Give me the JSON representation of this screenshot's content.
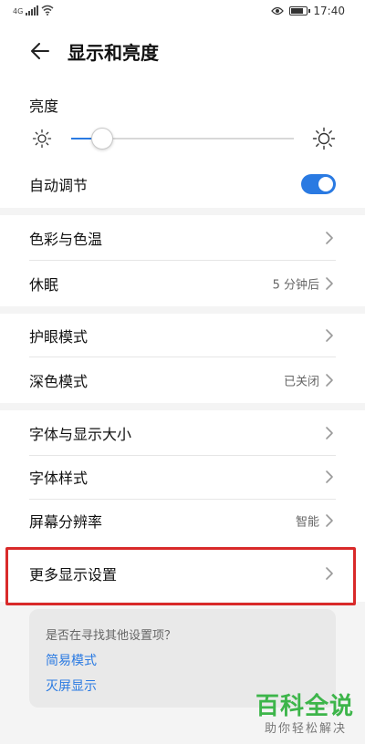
{
  "status_bar": {
    "network": "4G",
    "time": "17:40",
    "icons": [
      "signal-icon",
      "wifi-icon",
      "eye-icon",
      "battery-icon"
    ]
  },
  "header": {
    "title": "显示和亮度",
    "back_icon": "arrow-left-icon"
  },
  "brightness": {
    "label": "亮度",
    "level_percent": 14,
    "low_icon": "sun-small-icon",
    "high_icon": "sun-large-icon"
  },
  "auto_adjust": {
    "label": "自动调节",
    "enabled": true
  },
  "groups": [
    {
      "items": [
        {
          "label": "色彩与色温",
          "value": ""
        },
        {
          "label": "休眠",
          "value": "5 分钟后"
        }
      ]
    },
    {
      "items": [
        {
          "label": "护眼模式",
          "value": ""
        },
        {
          "label": "深色模式",
          "value": "已关闭"
        }
      ]
    },
    {
      "items": [
        {
          "label": "字体与显示大小",
          "value": ""
        },
        {
          "label": "字体样式",
          "value": ""
        },
        {
          "label": "屏幕分辨率",
          "value": "智能"
        },
        {
          "label": "更多显示设置",
          "value": ""
        }
      ]
    }
  ],
  "suggest": {
    "title": "是否在寻找其他设置项？",
    "links": [
      "简易模式",
      "灭屏显示"
    ]
  },
  "watermark": {
    "main": "百科全说",
    "sub": "助你轻松解决"
  },
  "colors": {
    "accent": "#2a7ae2",
    "highlight": "#d92a2a",
    "watermark": "#3db54a"
  }
}
